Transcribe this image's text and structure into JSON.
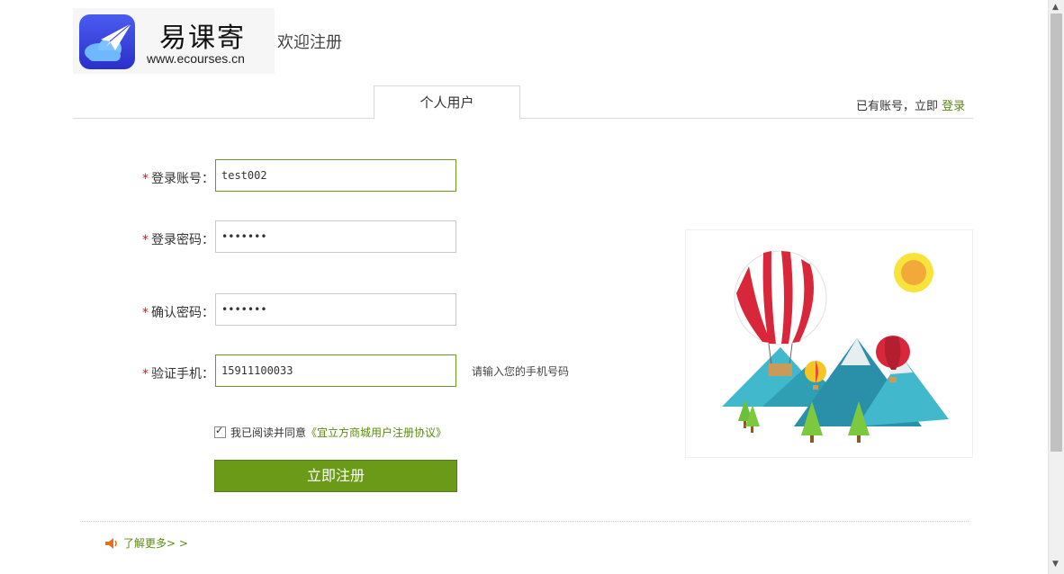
{
  "header": {
    "logo_name": "易课寄",
    "logo_url": "www.ecourses.cn",
    "welcome": "欢迎注册"
  },
  "tabs": [
    {
      "label": "个人用户",
      "active": true
    }
  ],
  "login_hint": {
    "text": "已有账号，立即",
    "link": "登录"
  },
  "form": {
    "account": {
      "label": "登录账号：",
      "value": "test002"
    },
    "password": {
      "label": "登录密码：",
      "value": "•••••••"
    },
    "confirm": {
      "label": "确认密码：",
      "value": "•••••••"
    },
    "phone": {
      "label": "验证手机：",
      "value": "15911100033",
      "hint": "请输入您的手机号码"
    },
    "required_mark": "*"
  },
  "agreement": {
    "checked": true,
    "text": "我已阅读并同意",
    "link": "《宜立方商城用户注册协议》"
  },
  "submit_label": "立即注册",
  "learn_more": "了解更多> >",
  "colors": {
    "accent": "#6b9a18",
    "link": "#5a8a10",
    "required": "#dd1122"
  }
}
